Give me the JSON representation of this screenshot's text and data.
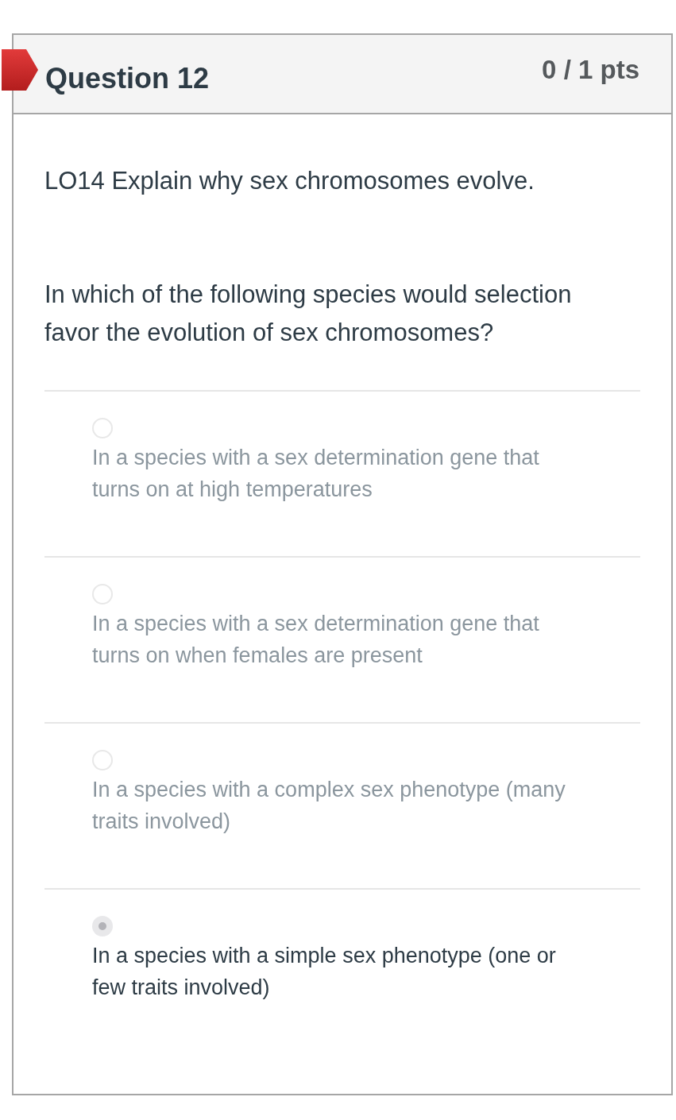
{
  "question": {
    "title": "Question 12",
    "points": "0 / 1 pts",
    "incorrect": true
  },
  "body": {
    "objective": "LO14 Explain why sex chromosomes evolve.",
    "prompt": "In which of the following species would selection favor the evolution of sex chromosomes?"
  },
  "answers": [
    {
      "text": "In a species with a sex determination gene that turns on at high temperatures",
      "selected": false
    },
    {
      "text": "In a species with a sex determination gene that turns on when females are present",
      "selected": false
    },
    {
      "text": "In a species with a complex sex phenotype (many traits involved)",
      "selected": false
    },
    {
      "text": "In a species with a simple sex phenotype (one or few traits involved)",
      "selected": true
    }
  ]
}
